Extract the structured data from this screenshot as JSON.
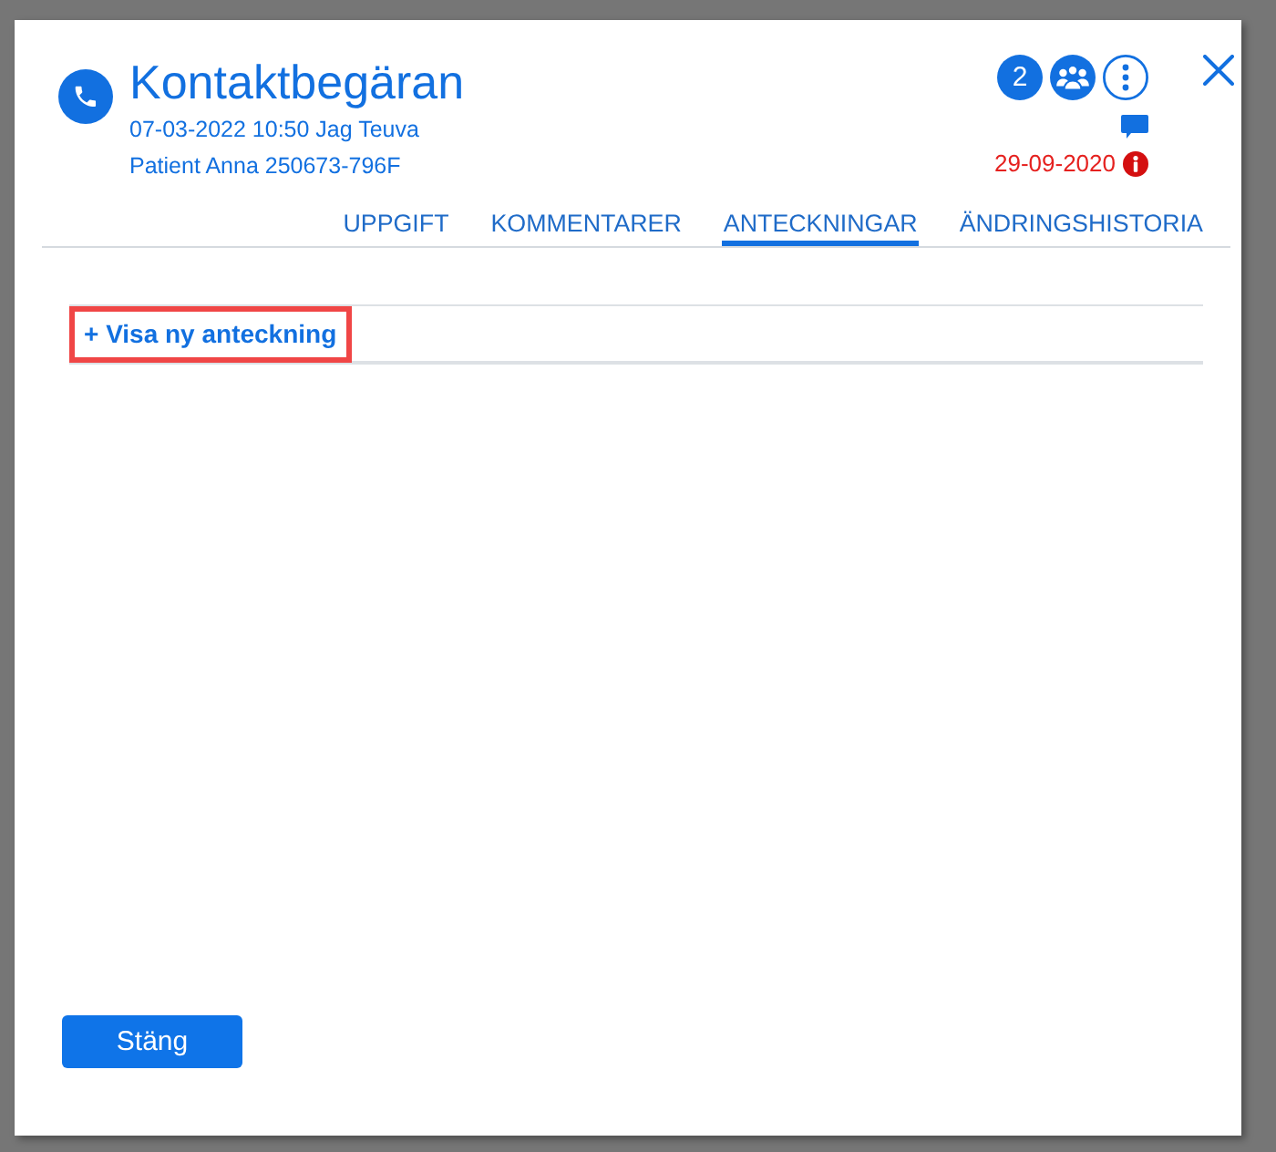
{
  "dialog": {
    "title": "Kontaktbegäran",
    "subtitle_lines": [
      "07-03-2022 10:50 Jag Teuva",
      "Patient Anna 250673-796F"
    ],
    "status": {
      "count": "2",
      "date": "29-09-2020",
      "overdue": true
    },
    "tabs": [
      {
        "label": "UPPGIFT",
        "selected": false
      },
      {
        "label": "KOMMENTARER",
        "selected": false
      },
      {
        "label": "ANTECKNINGAR",
        "selected": true
      },
      {
        "label": "ÄNDRINGSHISTORIA",
        "selected": false
      }
    ],
    "notes": {
      "add_link": {
        "label": "+ Visa ny anteckning",
        "highlighted": true
      }
    },
    "buttons": [
      {
        "label": "Stäng"
      }
    ]
  }
}
